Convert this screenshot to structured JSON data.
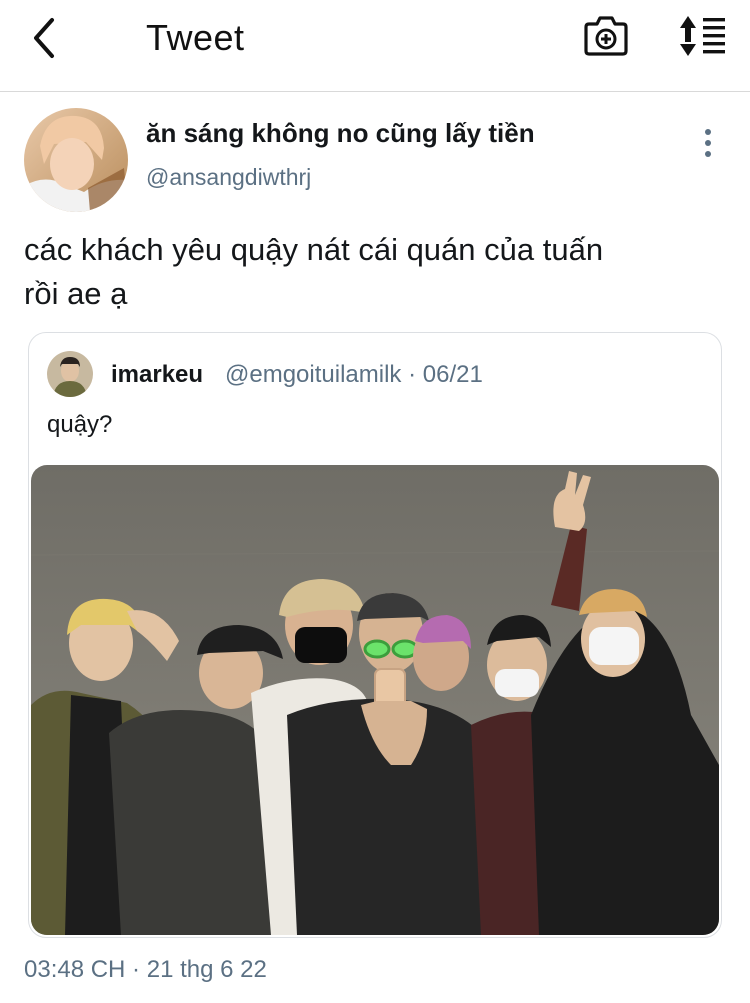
{
  "header": {
    "title": "Tweet",
    "back_icon": "chevron-left-icon",
    "camera_icon": "camera-plus-icon",
    "sort_icon": "sort-lines-icon"
  },
  "tweet": {
    "author_name": "ăn sáng không no cũng lấy tiền",
    "author_handle": "@ansangdiwthrj",
    "text_line1": "các khách yêu quậy nát cái quán của tuấn",
    "text_line2": "rồi ae ạ",
    "more_icon": "more-vertical-icon",
    "timestamp": "03:48 CH · 21 thg 6 22"
  },
  "quoted": {
    "author_name": "imarkeu",
    "author_handle": "@emgoituilamilk · 06/21",
    "text": "quậy?"
  },
  "colors": {
    "text": "#14171a",
    "secondary": "#5b7083",
    "border": "#dcdfe3"
  }
}
